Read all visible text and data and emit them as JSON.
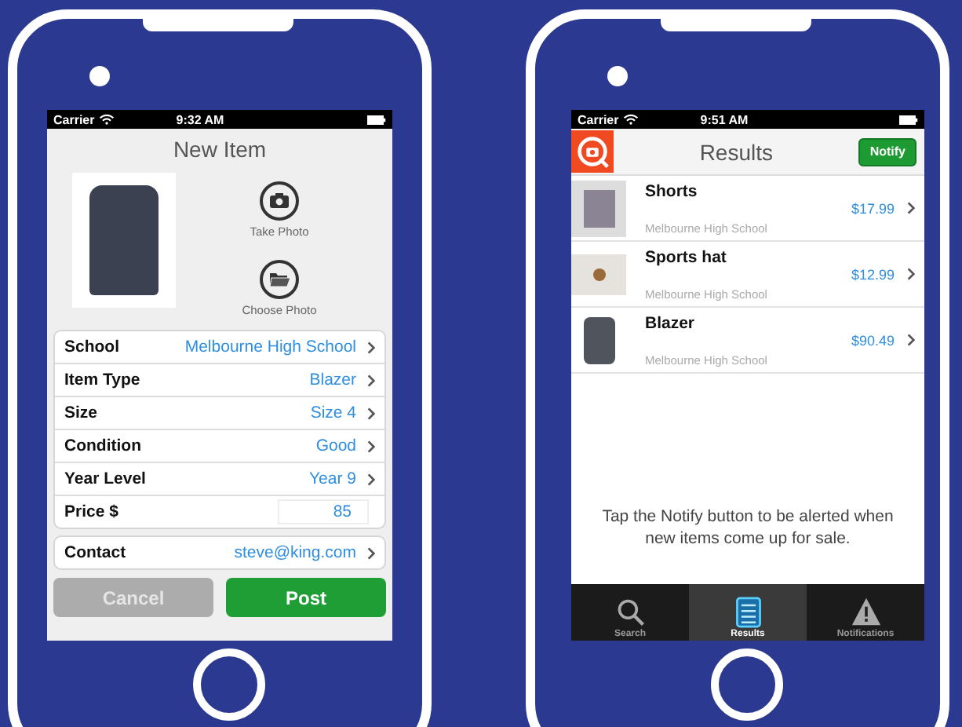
{
  "new_item_screen": {
    "status_bar": {
      "carrier": "Carrier",
      "time": "9:32 AM"
    },
    "title": "New Item",
    "photo_actions": [
      {
        "kind": "camera",
        "label": "Take Photo"
      },
      {
        "kind": "folder",
        "label": "Choose Photo"
      }
    ],
    "fields": [
      {
        "kind": "link",
        "label": "School",
        "value": "Melbourne High School"
      },
      {
        "kind": "link",
        "label": "Item Type",
        "value": "Blazer"
      },
      {
        "kind": "link",
        "label": "Size",
        "value": "Size 4"
      },
      {
        "kind": "link",
        "label": "Condition",
        "value": "Good"
      },
      {
        "kind": "link",
        "label": "Year Level",
        "value": "Year 9"
      },
      {
        "kind": "input",
        "label": "Price $",
        "value": "85"
      }
    ],
    "contact": {
      "label": "Contact",
      "value": "steve@king.com"
    },
    "buttons": [
      {
        "kind": "cancel",
        "label": "Cancel"
      },
      {
        "kind": "primary",
        "label": "Post"
      }
    ]
  },
  "results_screen": {
    "status_bar": {
      "carrier": "Carrier",
      "time": "9:51 AM"
    },
    "title": "Results",
    "notify_button": "Notify",
    "results": [
      {
        "kind": "shorts",
        "name": "Shorts",
        "school": "Melbourne High School",
        "price": "$17.99"
      },
      {
        "kind": "hat",
        "name": "Sports hat",
        "school": "Melbourne High School",
        "price": "$12.99"
      },
      {
        "kind": "blazer",
        "name": "Blazer",
        "school": "Melbourne High School",
        "price": "$90.49"
      }
    ],
    "message": "Tap the Notify button to be alerted when new items come up for sale.",
    "tabs": [
      {
        "kind": "search",
        "label": "Search",
        "selected": false
      },
      {
        "kind": "list",
        "label": "Results",
        "selected": true
      },
      {
        "kind": "alert",
        "label": "Notifications",
        "selected": false
      }
    ]
  }
}
